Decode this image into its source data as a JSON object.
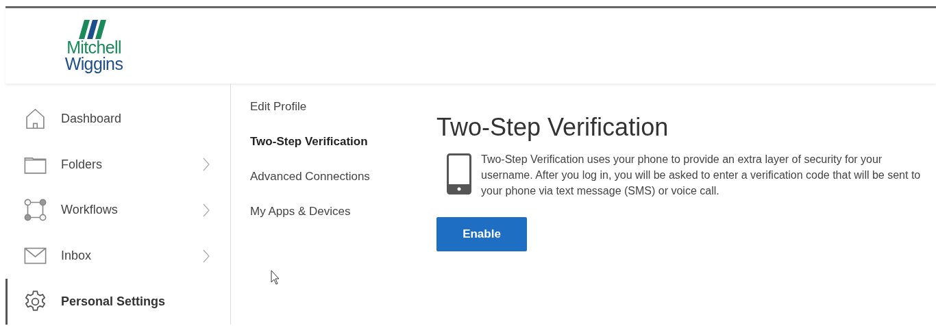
{
  "logo": {
    "line_1": "Mitchell",
    "line_2": "Wiggins"
  },
  "sidebar": {
    "items": [
      {
        "label": "Dashboard",
        "selected": false,
        "expandable": false
      },
      {
        "label": "Folders",
        "selected": false,
        "expandable": true
      },
      {
        "label": "Workflows",
        "selected": false,
        "expandable": true
      },
      {
        "label": "Inbox",
        "selected": false,
        "expandable": true
      },
      {
        "label": "Personal Settings",
        "selected": true,
        "expandable": false
      }
    ]
  },
  "settings_menu": {
    "items": [
      {
        "label": "Edit Profile",
        "selected": false
      },
      {
        "label": "Two-Step Verification",
        "selected": true
      },
      {
        "label": "Advanced Connections",
        "selected": false
      },
      {
        "label": "My Apps & Devices",
        "selected": false
      }
    ]
  },
  "content": {
    "title": "Two-Step Verification",
    "description": "Two-Step Verification uses your phone to provide an extra layer of security for your username. After you log in, you will be asked to enter a verification code that will be sent to your phone via text message (SMS) or voice call.",
    "button": "Enable"
  }
}
